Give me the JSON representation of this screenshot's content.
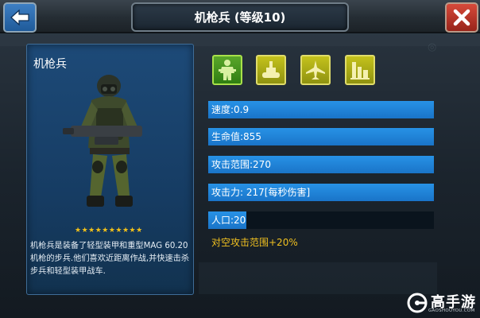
{
  "header": {
    "title": "机枪兵 (等级10)",
    "back_icon": "arrow-left-icon",
    "close_icon": "close-x-icon"
  },
  "unit": {
    "name": "机枪兵",
    "stars": "★★★★★★★★★★",
    "star_count": 10,
    "description": "机枪兵是装备了轻型装甲和重型MAG 60.20机枪的步兵.他们喜欢近距离作战,并快速击杀步兵和轻型装甲战车."
  },
  "categories": [
    {
      "icon": "infantry-icon",
      "active": true
    },
    {
      "icon": "tank-icon",
      "active": false
    },
    {
      "icon": "aircraft-icon",
      "active": false
    },
    {
      "icon": "building-icon",
      "active": false
    }
  ],
  "stats": [
    {
      "label": "速度:0.9",
      "fill_fraction": 1.0
    },
    {
      "label": "生命值:855",
      "fill_fraction": 1.0
    },
    {
      "label": "攻击范围:270",
      "fill_fraction": 1.0
    },
    {
      "label": "攻击力: 217[每秒伤害]",
      "fill_fraction": 1.0
    },
    {
      "label": "人口:20",
      "fill_fraction": 0.17
    }
  ],
  "bonus": "对空攻击范围+20%",
  "watermark": {
    "name": "高手游",
    "url": "GAOSHOUYOU.COM"
  },
  "colors": {
    "stat_fill": "#1a74c8",
    "bonus_text": "#f0c020",
    "close_button": "#c0392b",
    "back_button": "#2a6fb5"
  }
}
